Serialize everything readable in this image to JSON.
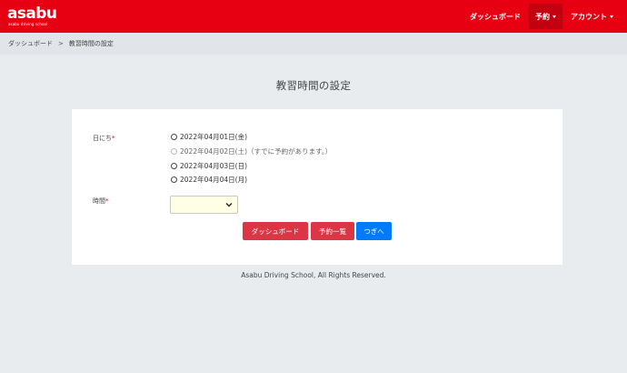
{
  "brand": {
    "name": "asabu",
    "tagline": "asabu driving school"
  },
  "nav": {
    "dashboard": "ダッシュボード",
    "reservation": "予約",
    "account": "アカウント"
  },
  "breadcrumb": {
    "home": "ダッシュボード",
    "separator": ">",
    "current": "教習時間の設定"
  },
  "page_title": "教習時間の設定",
  "form": {
    "date_label": "日にち",
    "required_mark": "*",
    "date_options": [
      {
        "label": "2022年04月01日(金)",
        "disabled": false
      },
      {
        "label": "2022年04月02日(土)（すでに予約があります。）",
        "disabled": true
      },
      {
        "label": "2022年04月03日(日)",
        "disabled": false
      },
      {
        "label": "2022年04月04日(月)",
        "disabled": false
      }
    ],
    "time_label": "時間",
    "time_selected": ""
  },
  "buttons": {
    "dashboard": "ダッシュボード",
    "reservation_list": "予約一覧",
    "next": "つぎへ"
  },
  "footer": "Asabu Driving School, All Rights Reserved.",
  "colors": {
    "brand_red": "#e60012",
    "button_red": "#dc3545",
    "button_blue": "#007bff",
    "select_bg": "#ffffe6"
  }
}
